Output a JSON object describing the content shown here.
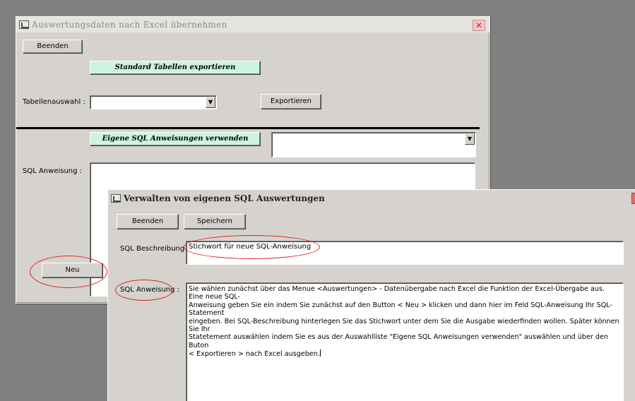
{
  "main_window": {
    "title": "Auswertungsdaten nach Excel übernehmen",
    "buttons": {
      "beenden": "Beenden",
      "standard_export": "Standard Tabellen exportieren",
      "exportieren": "Exportieren",
      "eigene_sql": "Eigene SQL Anweisungen verwenden",
      "neu": "Neu"
    },
    "labels": {
      "tabellenauswahl": "Tabellenauswahl :",
      "sql_anweisung": "SQL Anweisung :"
    },
    "tabellenauswahl_value": "",
    "sql_select_value": "",
    "sql_anweisung_value": ""
  },
  "dialog": {
    "title": "Verwalten von eigenen SQL Auswertungen",
    "buttons": {
      "beenden": "Beenden",
      "speichern": "Speichern"
    },
    "labels": {
      "sql_beschreibung": "SQL Beschreibung :",
      "sql_anweisung": "SQL Anweisung :"
    },
    "sql_beschreibung_value": "Stichwort für neue SQL-Anweisung",
    "sql_anweisung_text": "Sie wählen zunächst über das Menue <Auswertungen> - Datenübergabe nach Excel die Funktion der Excel-Übergabe aus. Eine neue SQL-\nAnweisung geben Sie ein indem Sie zunächst auf den Button < Neu > klicken und dann hier im Feld SQL-Anweisung Ihr SQL-Statement\neingeben. Bei SQL-Beschreibung hinterlegen Sie das Stichwort unter dem Sie die Ausgabe wiederfinden wollen. Später können Sie Ihr\nStatetement auswählen indem Sie es aus der Auswahlliste \"Eigene SQL Anweisungen verwenden\" auswählen und über den Buton\n< Exportieren > nach Excel ausgeben."
  },
  "icons": {
    "window_icon": "excel-sheet-icon",
    "close": "close-icon",
    "dropdown": "chevron-down-icon"
  },
  "colors": {
    "window_bg": "#d6d3ce",
    "desktop": "#808080",
    "green_button": "#ccf5e0",
    "annotation": "#dd2222"
  }
}
